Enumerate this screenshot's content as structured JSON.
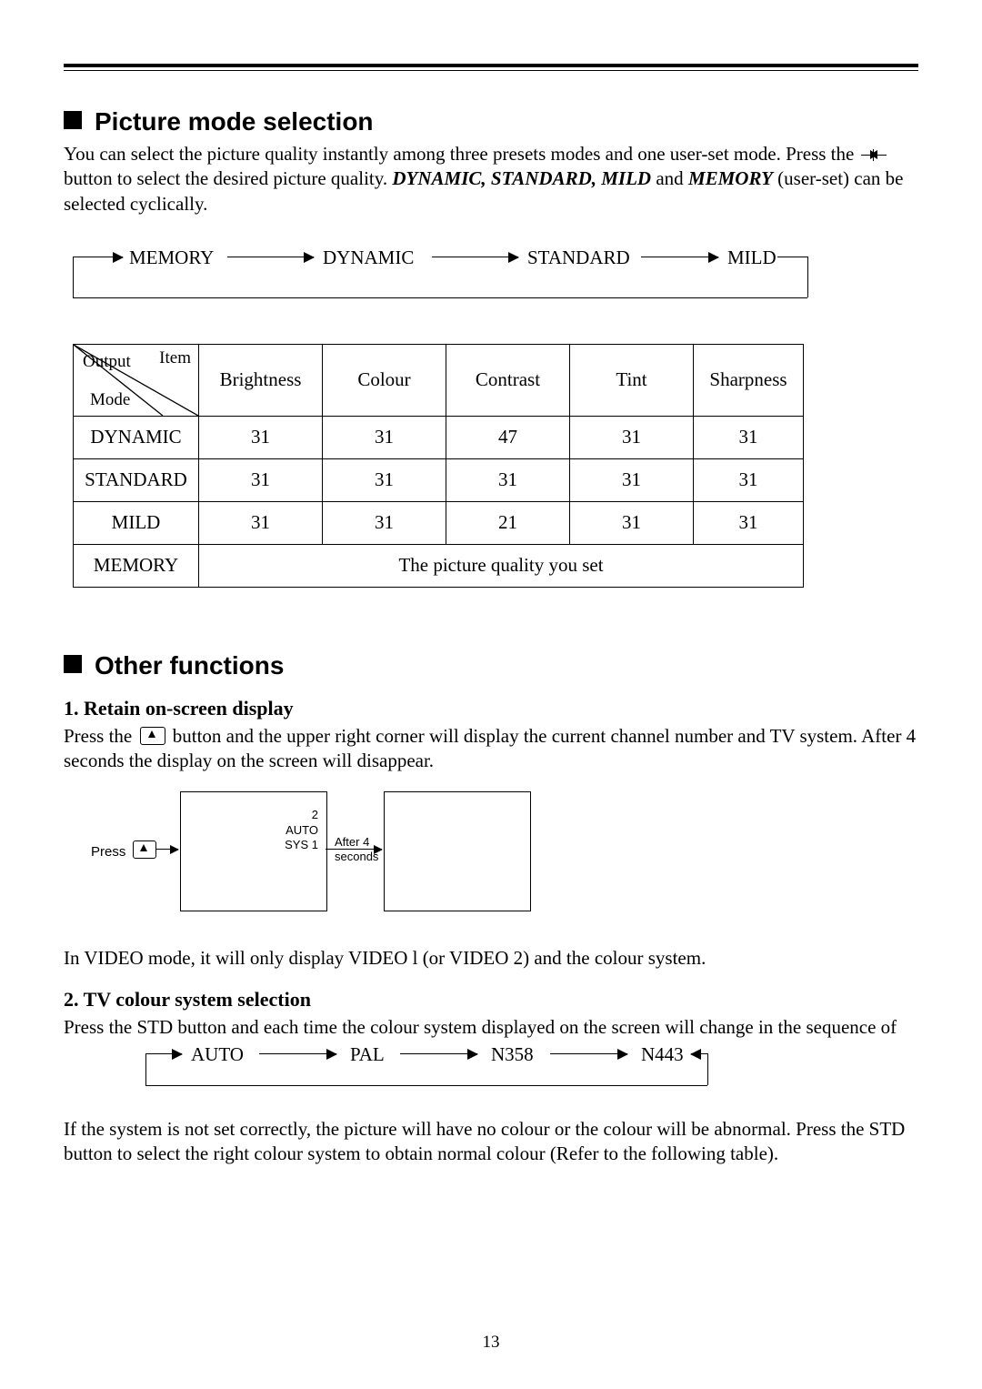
{
  "section1": {
    "title": "Picture mode selection",
    "intro_a": "You can select the picture quality instantly among three presets modes and one user-set mode. Press the",
    "intro_b": "button to select the desired picture quality.",
    "modes_bi": "DYNAMIC, STANDARD, MILD",
    "intro_c": " and ",
    "memory_bi": "MEMORY",
    "intro_d": " (user-set) can be selected cyclically.",
    "cycle": [
      "MEMORY",
      "DYNAMIC",
      "STANDARD",
      "MILD"
    ],
    "table": {
      "diag_item": "Item",
      "diag_output": "Output",
      "diag_mode": "Mode",
      "cols": [
        "Brightness",
        "Colour",
        "Contrast",
        "Tint",
        "Sharpness"
      ],
      "rows": [
        {
          "name": "DYNAMIC",
          "vals": [
            "31",
            "31",
            "47",
            "31",
            "31"
          ]
        },
        {
          "name": "STANDARD",
          "vals": [
            "31",
            "31",
            "31",
            "31",
            "31"
          ]
        },
        {
          "name": "MILD",
          "vals": [
            "31",
            "31",
            "21",
            "31",
            "31"
          ]
        }
      ],
      "memory_row_name": "MEMORY",
      "memory_row_text": "The picture quality you set"
    }
  },
  "section2": {
    "title": "Other functions",
    "sub1": "1. Retain on-screen display",
    "p1a": "Press the ",
    "p1b": " button and the upper right corner will display the current channel number and TV system. After 4 seconds the display on the screen will disappear.",
    "osd": {
      "press": "Press",
      "line1": "2",
      "line2": "AUTO",
      "line3": "SYS 1",
      "after": "After 4\nseconds"
    },
    "p2": "In VIDEO mode, it will only display VIDEO l (or VIDEO 2) and the colour system.",
    "sub2": "2. TV colour system selection",
    "p3": "Press the STD button and each time the colour system displayed on the screen will change in the sequence of",
    "cycle2": [
      "AUTO",
      "PAL",
      "N358",
      "N443"
    ],
    "p4": "If the system is not set correctly, the picture will have no colour or the colour will be abnormal. Press the STD button to select the right colour system to obtain normal colour (Refer to the following table)."
  },
  "page_number": "13",
  "chart_data": {
    "type": "table",
    "title": "Picture mode preset values",
    "columns": [
      "Mode",
      "Brightness",
      "Colour",
      "Contrast",
      "Tint",
      "Sharpness"
    ],
    "rows": [
      [
        "DYNAMIC",
        31,
        31,
        47,
        31,
        31
      ],
      [
        "STANDARD",
        31,
        31,
        31,
        31,
        31
      ],
      [
        "MILD",
        31,
        31,
        21,
        31,
        31
      ],
      [
        "MEMORY",
        "The picture quality you set",
        null,
        null,
        null,
        null
      ]
    ]
  }
}
